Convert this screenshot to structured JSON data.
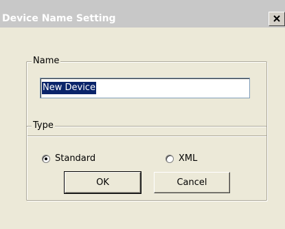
{
  "window": {
    "title": "Device Name Setting"
  },
  "name_group": {
    "legend": "Name",
    "input_value": "New Device"
  },
  "type_group": {
    "legend": "Type",
    "options": [
      {
        "label": "Standard",
        "selected": true
      },
      {
        "label": "XML",
        "selected": false
      }
    ]
  },
  "buttons": {
    "ok_label": "OK",
    "cancel_label": "Cancel"
  },
  "icons": {
    "close": "close-icon"
  },
  "colors": {
    "selection_background": "#0a246a",
    "dialog_background": "#ece9d8"
  }
}
